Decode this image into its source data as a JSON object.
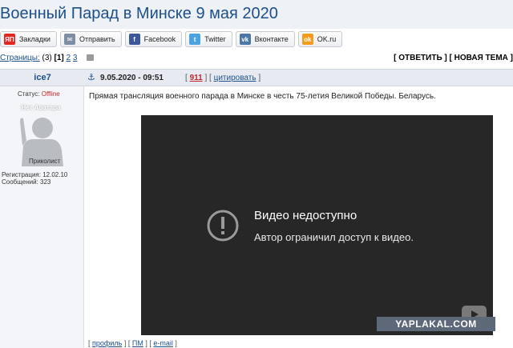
{
  "page": {
    "title": "Военный Парад в Минске 9 мая 2020"
  },
  "share": [
    {
      "label": "Закладки",
      "icon": "yandex-icon",
      "color": "#e52620",
      "glyph": "ЯП"
    },
    {
      "label": "Отправить",
      "icon": "mail-icon",
      "color": "#7e8ea4",
      "glyph": "✉"
    },
    {
      "label": "Facebook",
      "icon": "facebook-icon",
      "color": "#3b5998",
      "glyph": "f"
    },
    {
      "label": "Twitter",
      "icon": "twitter-icon",
      "color": "#4aa3df",
      "glyph": "t"
    },
    {
      "label": "Вконтакте",
      "icon": "vk-icon",
      "color": "#4a76a8",
      "glyph": "vk"
    },
    {
      "label": "OK.ru",
      "icon": "odnoklassniki-icon",
      "color": "#f59a1a",
      "glyph": "ok"
    }
  ],
  "pagination": {
    "label": "Страницы:",
    "count": "(3)",
    "current": "[1]",
    "page2": "2",
    "page3": "3"
  },
  "actions": {
    "reply": "[ ОТВЕТИТЬ ]",
    "new_topic": "[ НОВАЯ ТЕМА ]"
  },
  "post": {
    "author": "ice7",
    "date": "9.05.2020 - 09:51",
    "open_bracket": "[",
    "rating": "911",
    "sep": "] [",
    "quote": "цитировать",
    "close_bracket": "]",
    "text": "Прямая трансляция военного парада в Минске в честь 75-летия Великой Победы. Беларусь."
  },
  "user": {
    "status_label": "Статус:",
    "status_value": "Offline",
    "no_avatar": "Нет Аватара",
    "rank": "Приколист",
    "registered": "Регистрация: 12.02.10",
    "messages": "Сообщений: 323"
  },
  "video": {
    "title": "Видео недоступно",
    "subtitle": "Автор ограничил доступ к видео."
  },
  "watermark": "YAPLAKAL.COM",
  "footer": {
    "b1": "[",
    "profile": "профиль",
    "b2": "] [",
    "pm": "ПМ",
    "b3": "] [",
    "email": "e-mail",
    "b4": "]"
  }
}
